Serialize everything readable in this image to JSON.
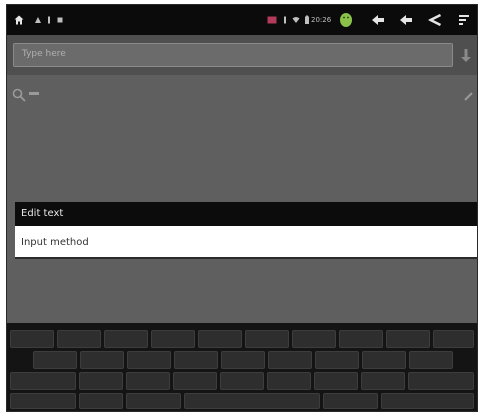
{
  "status_bar": {
    "icons_left": [
      "home-icon",
      "notification-icon",
      "notification-icon",
      "notification-icon"
    ],
    "time": "20:26",
    "icons_right": [
      "android-icon",
      "back-arrow-icon",
      "back-arrow-icon",
      "share-icon",
      "menu-icon"
    ]
  },
  "search": {
    "placeholder": "Type here"
  },
  "dialog": {
    "title": "Edit text",
    "item_label": "Input method"
  },
  "colors": {
    "background": "#5f5f5f",
    "dialog_title_bg": "#0c0c0c",
    "dialog_item_bg": "#ffffff",
    "keyboard_bg": "#141414",
    "android_green": "#8bc34a"
  }
}
